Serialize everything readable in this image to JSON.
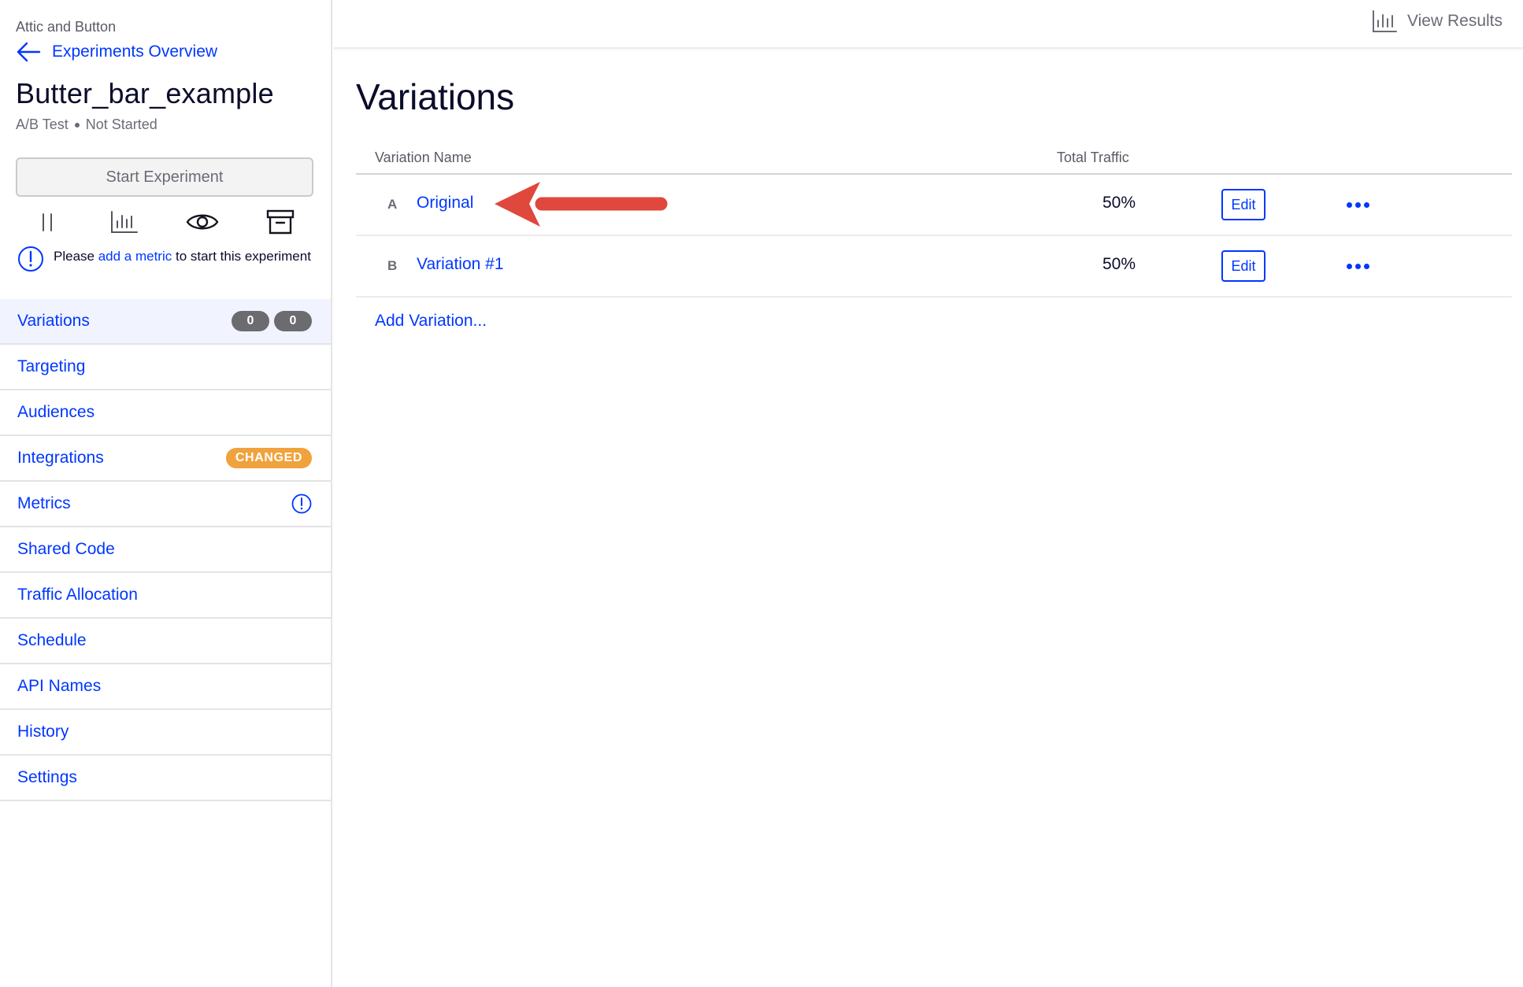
{
  "sidebar": {
    "project_name": "Attic and Button",
    "back_link": "Experiments Overview",
    "experiment_title": "Butter_bar_example",
    "experiment_type": "A/B Test",
    "experiment_status": "Not Started",
    "start_button": "Start Experiment",
    "notice": {
      "prefix": "Please ",
      "link": "add a metric",
      "suffix": " to start this experiment"
    },
    "nav": [
      {
        "label": "Variations",
        "active": true,
        "counts": [
          "0",
          "0"
        ]
      },
      {
        "label": "Targeting"
      },
      {
        "label": "Audiences"
      },
      {
        "label": "Integrations",
        "badge": "CHANGED"
      },
      {
        "label": "Metrics",
        "icon": "warning-icon"
      },
      {
        "label": "Shared Code"
      },
      {
        "label": "Traffic Allocation"
      },
      {
        "label": "Schedule"
      },
      {
        "label": "API Names"
      },
      {
        "label": "History"
      },
      {
        "label": "Settings"
      }
    ]
  },
  "topbar": {
    "view_results": "View Results"
  },
  "main": {
    "title": "Variations",
    "columns": {
      "name": "Variation Name",
      "traffic": "Total Traffic"
    },
    "rows": [
      {
        "letter": "A",
        "name": "Original",
        "traffic": "50%",
        "edit": "Edit"
      },
      {
        "letter": "B",
        "name": "Variation #1",
        "traffic": "50%",
        "edit": "Edit"
      }
    ],
    "add_variation": "Add Variation..."
  },
  "colors": {
    "link_blue": "#0037ff",
    "badge_orange": "#f0a23c",
    "annotation_red": "#e0473d",
    "active_bg": "#f1f3ff"
  }
}
